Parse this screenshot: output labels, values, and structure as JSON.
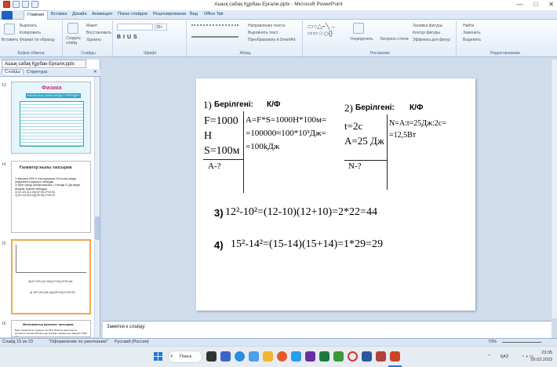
{
  "window": {
    "title": "Ашық сабақ Құрбан Ерғали.pptx - Microsoft PowerPoint",
    "controls": [
      "—",
      "□",
      "✕"
    ]
  },
  "ribbon": {
    "tabs": [
      "Главная",
      "Вставка",
      "Дизайн",
      "Анимация",
      "Показ слайдов",
      "Рецензирование",
      "Вид",
      "Office Tab"
    ],
    "clipboard": {
      "paste": "Вставить",
      "cut": "Вырезать",
      "copy": "Копировать",
      "format": "Формат по образцу",
      "label": "Буфер обмена"
    },
    "slides": {
      "create": "Создать слайд",
      "layout": "Макет",
      "reset": "Восстановить",
      "delete": "Удалить",
      "label": "Слайды"
    },
    "font": {
      "label": "Шрифт",
      "size_value": "32+"
    },
    "paragraph": {
      "direction": "Направление текста",
      "align": "Выровнять текст",
      "smartart": "Преобразовать в SmartArt",
      "label": "Абзац"
    },
    "drawing": {
      "arrange": "Упорядочить",
      "quickstyles": "Экспресс-стили",
      "fill": "Заливка фигуры",
      "outline": "Контур фигуры",
      "effects": "Эффекты для фигур",
      "label": "Рисование"
    },
    "editing": {
      "find": "Найти",
      "replace": "Заменить",
      "select": "Выделить",
      "label": "Редактирование"
    }
  },
  "pane": {
    "file_tab": "Ашық сабақ Құрбан Ерғали.pptx",
    "tab_slides": "Слайды",
    "tab_outline": "Структура",
    "thumbs": [
      {
        "num": "13",
        "title": "Физика",
        "sub": "ФИЗИКАЛЫҚ ШАМАЛАРДЫ ТҮРЛЕНДІРУ"
      },
      {
        "num": "14",
        "title": "Ғаламтор жылы тапсырма",
        "lines": [
          "1) Массасы 2000 Н егер ауырлығы 100 м кесу жерде, атқарылатын жұмысты табыңдар",
          "2) Жүгіс (жеңу) тасыма массасы 1 тоннада 21 Дж жерде жылдам, күшыне табыңдар",
          "3) 12²-10²=(12-10)(12+10)=2*22=44",
          "4) 15²-14²=(15-14)(15+14)=1*29=29"
        ]
      },
      {
        "num": "15",
        "lines": [
          "3)12²-10²=(12-10)(12+10)=2*22=44",
          "4) 15²-14²=(15-14)(15+14)=1*29=29"
        ]
      },
      {
        "num": "16",
        "title": "Механикалық қозғалыс тапсырма:",
        "lines": [
          "Вася, Қазақ 5,6 м³ тұрақты газ 38 м биіктікке қарсыласты көтерілуге жетеді массасы деп бөлімін. Жұмыстың тиімділігі 7048 м/с"
        ]
      }
    ]
  },
  "slide": {
    "p1_label": "1)",
    "p1_given": "Берілгені:",
    "p1_kf": "К/Ф",
    "p1_left": [
      "F=1000",
      "Н",
      "S=100м"
    ],
    "p1_find": "A-?",
    "p1_right": [
      "A=F*S=1000Н*100м=",
      "=100000≈100*10³Дж=",
      "=100kДж"
    ],
    "p2_label": "2)",
    "p2_given": "Берілгені:",
    "p2_kf": "К/Ф",
    "p2_left": [
      "t=2с",
      "A=25 Дж"
    ],
    "p2_find": "N-?",
    "p2_right": [
      "N=A:t=25Дж:2с=",
      "=12,5Вт"
    ],
    "eq3_num": "3)",
    "eq3": "12²-10²=(12-10)(12+10)=2*22=44",
    "eq4_num": "4)",
    "eq4": "15²-14²=(15-14)(15+14)=1*29=29"
  },
  "notes": {
    "placeholder": "Заметки к слайду"
  },
  "status": {
    "slide": "Слайд 15 из 23",
    "theme": "\"Оформление по умолчанию\"",
    "lang": "Русский (Россия)",
    "zoom": "73%"
  },
  "taskbar": {
    "search": "Поиск",
    "lang": "ҚАЗ",
    "time": "23:35",
    "date": "09.03.2023"
  }
}
